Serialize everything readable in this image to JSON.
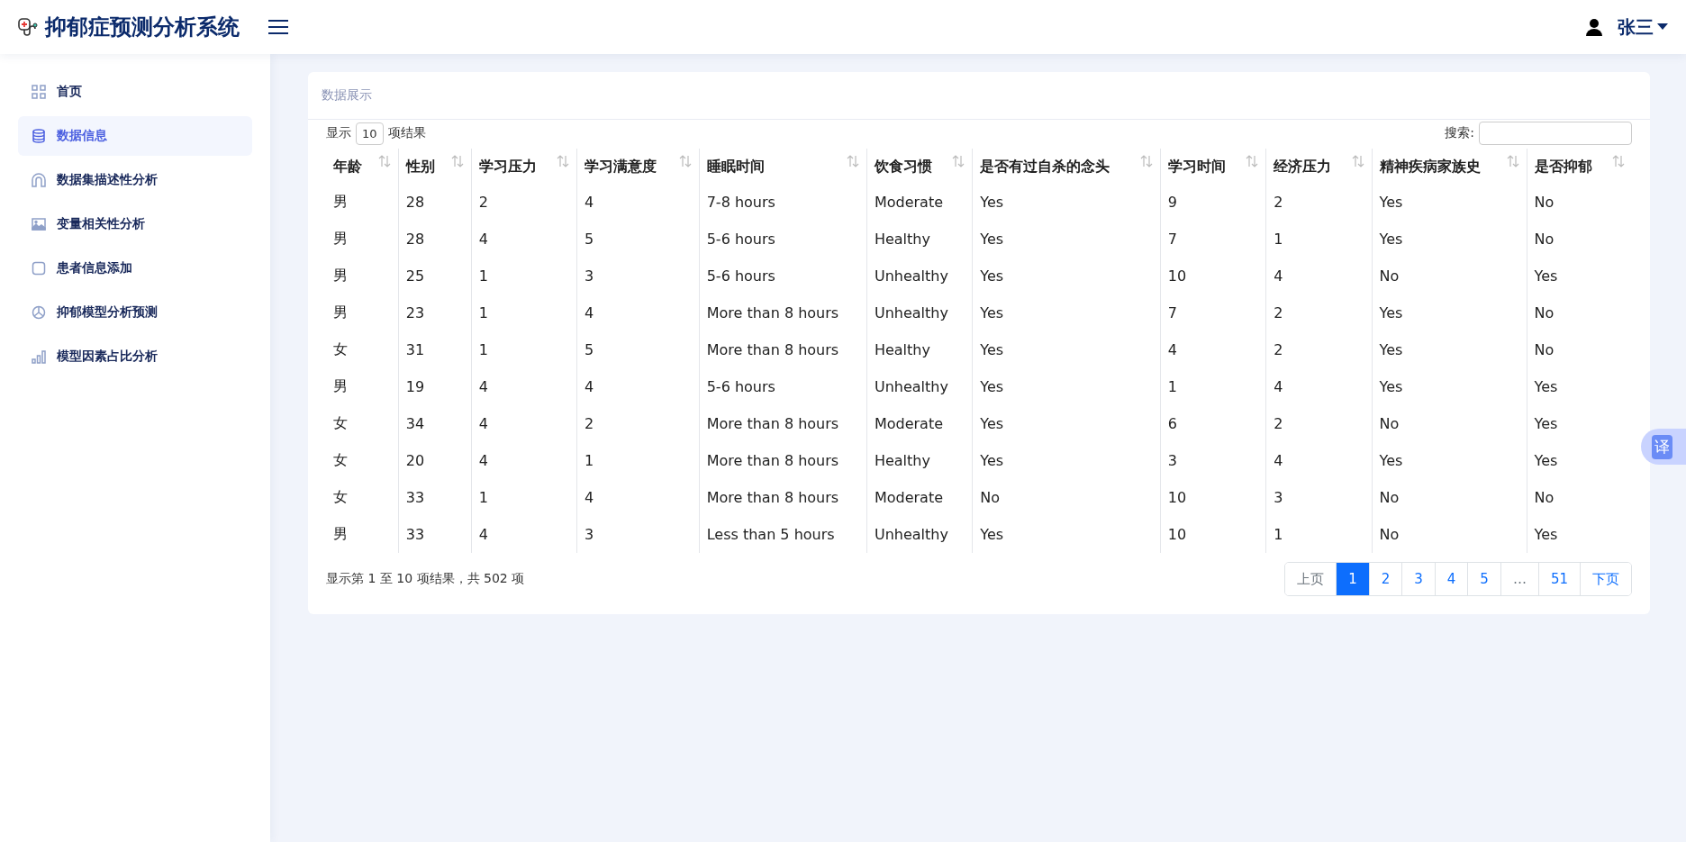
{
  "header": {
    "title": "抑郁症预测分析系统",
    "user": "张三"
  },
  "sidebar": {
    "items": [
      {
        "label": "首页",
        "selected": false
      },
      {
        "label": "数据信息",
        "selected": true
      },
      {
        "label": "数据集描述性分析",
        "selected": false
      },
      {
        "label": "变量相关性分析",
        "selected": false
      },
      {
        "label": "患者信息添加",
        "selected": false
      },
      {
        "label": "抑郁模型分析预测",
        "selected": false
      },
      {
        "label": "模型因素占比分析",
        "selected": false
      }
    ]
  },
  "card": {
    "title": "数据展示",
    "length_prefix": "显示",
    "page_length": "10",
    "length_suffix": "项结果",
    "search_label": "搜索:",
    "table": {
      "columns": [
        "年龄",
        "性别",
        "学习压力",
        "学习满意度",
        "睡眠时间",
        "饮食习惯",
        "是否有过自杀的念头",
        "学习时间",
        "经济压力",
        "精神疾病家族史",
        "是否抑郁"
      ],
      "rows": [
        [
          "男",
          "28",
          "2",
          "4",
          "7-8 hours",
          "Moderate",
          "Yes",
          "9",
          "2",
          "Yes",
          "No"
        ],
        [
          "男",
          "28",
          "4",
          "5",
          "5-6 hours",
          "Healthy",
          "Yes",
          "7",
          "1",
          "Yes",
          "No"
        ],
        [
          "男",
          "25",
          "1",
          "3",
          "5-6 hours",
          "Unhealthy",
          "Yes",
          "10",
          "4",
          "No",
          "Yes"
        ],
        [
          "男",
          "23",
          "1",
          "4",
          "More than 8 hours",
          "Unhealthy",
          "Yes",
          "7",
          "2",
          "Yes",
          "No"
        ],
        [
          "女",
          "31",
          "1",
          "5",
          "More than 8 hours",
          "Healthy",
          "Yes",
          "4",
          "2",
          "Yes",
          "No"
        ],
        [
          "男",
          "19",
          "4",
          "4",
          "5-6 hours",
          "Unhealthy",
          "Yes",
          "1",
          "4",
          "Yes",
          "Yes"
        ],
        [
          "女",
          "34",
          "4",
          "2",
          "More than 8 hours",
          "Moderate",
          "Yes",
          "6",
          "2",
          "No",
          "Yes"
        ],
        [
          "女",
          "20",
          "4",
          "1",
          "More than 8 hours",
          "Healthy",
          "Yes",
          "3",
          "4",
          "Yes",
          "Yes"
        ],
        [
          "女",
          "33",
          "1",
          "4",
          "More than 8 hours",
          "Moderate",
          "No",
          "10",
          "3",
          "No",
          "No"
        ],
        [
          "男",
          "33",
          "4",
          "3",
          "Less than 5 hours",
          "Unhealthy",
          "Yes",
          "10",
          "1",
          "No",
          "Yes"
        ]
      ]
    },
    "info": "显示第 1 至 10 项结果，共 502 项",
    "pagination": [
      {
        "label": "上页",
        "selected": false,
        "disabled": true
      },
      {
        "label": "1",
        "selected": true,
        "disabled": false
      },
      {
        "label": "2",
        "selected": false,
        "disabled": false
      },
      {
        "label": "3",
        "selected": false,
        "disabled": false
      },
      {
        "label": "4",
        "selected": false,
        "disabled": false
      },
      {
        "label": "5",
        "selected": false,
        "disabled": false
      },
      {
        "label": "…",
        "selected": false,
        "disabled": true
      },
      {
        "label": "51",
        "selected": false,
        "disabled": false
      },
      {
        "label": "下页",
        "selected": false,
        "disabled": false
      }
    ]
  },
  "translate_button": {
    "label": "译"
  }
}
